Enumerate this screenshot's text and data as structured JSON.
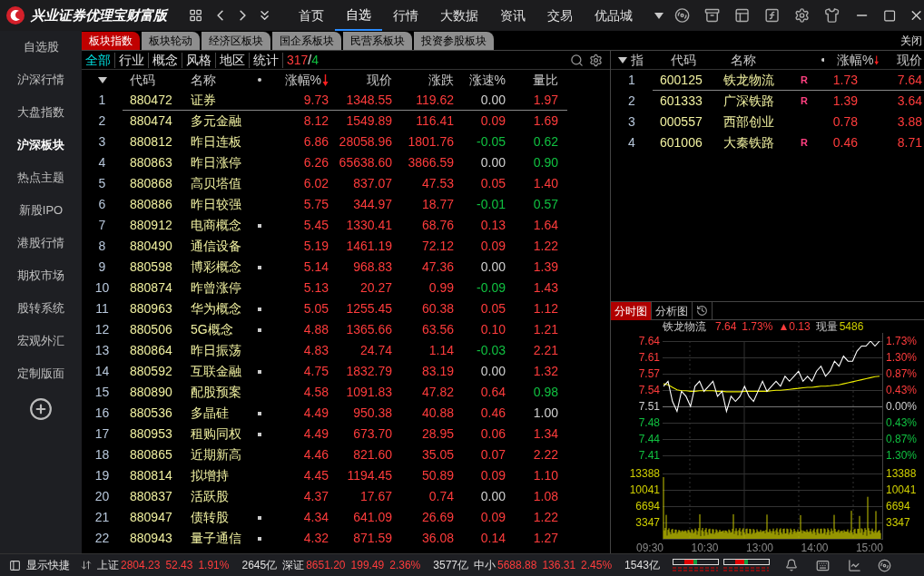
{
  "app": {
    "title": "兴业证券优理宝财富版"
  },
  "nav": [
    {
      "label": "首页",
      "selected": false
    },
    {
      "label": "自选",
      "selected": true
    },
    {
      "label": "行情",
      "selected": false
    },
    {
      "label": "大数据",
      "selected": false
    },
    {
      "label": "资讯",
      "selected": false
    },
    {
      "label": "交易",
      "selected": false
    },
    {
      "label": "优品城",
      "selected": false
    }
  ],
  "sidebar": {
    "items": [
      {
        "label": "自选股",
        "selected": false
      },
      {
        "label": "沪深行情",
        "selected": false
      },
      {
        "label": "大盘指数",
        "selected": false
      },
      {
        "label": "沪深板块",
        "selected": true
      },
      {
        "label": "热点主题",
        "selected": false
      },
      {
        "label": "新股IPO",
        "selected": false
      },
      {
        "label": "港股行情",
        "selected": false
      },
      {
        "label": "期权市场",
        "selected": false
      },
      {
        "label": "股转系统",
        "selected": false
      },
      {
        "label": "宏观外汇",
        "selected": false
      },
      {
        "label": "定制版面",
        "selected": false
      }
    ]
  },
  "board_tabs": [
    {
      "label": "板块指数",
      "selected": true
    },
    {
      "label": "板块轮动",
      "selected": false
    },
    {
      "label": "经济区板块",
      "selected": false
    },
    {
      "label": "国企系板块",
      "selected": false
    },
    {
      "label": "民营系板块",
      "selected": false
    },
    {
      "label": "投资参股板块",
      "selected": false
    }
  ],
  "close_label": "关闭",
  "filters": [
    {
      "label": "全部",
      "selected": true
    },
    {
      "label": "行业",
      "selected": false
    },
    {
      "label": "概念",
      "selected": false
    },
    {
      "label": "风格",
      "selected": false
    },
    {
      "label": "地区",
      "selected": false
    },
    {
      "label": "统计",
      "selected": false
    }
  ],
  "count": {
    "up": "317",
    "separator": "/",
    "down": "4"
  },
  "table": {
    "columns": [
      {
        "label": "代码",
        "sorted": false
      },
      {
        "label": "名称",
        "sorted": false
      },
      {
        "label": "涨幅%",
        "sorted": true
      },
      {
        "label": "现价",
        "sorted": false
      },
      {
        "label": "涨跌",
        "sorted": false
      },
      {
        "label": "涨速%",
        "sorted": false
      },
      {
        "label": "量比",
        "sorted": false
      }
    ],
    "rows": [
      {
        "index": "1",
        "code": "880472",
        "name": "证券",
        "marked": false,
        "selected": true,
        "values": [
          {
            "text": "9.73",
            "color": "#ff3c3c"
          },
          {
            "text": "1348.55",
            "color": "#ff3c3c"
          },
          {
            "text": "119.62",
            "color": "#ff3c3c"
          },
          {
            "text": "0.00",
            "color": "#d0d0d0"
          },
          {
            "text": "1.97",
            "color": "#ff3c3c"
          }
        ]
      },
      {
        "index": "2",
        "code": "880474",
        "name": "多元金融",
        "marked": false,
        "selected": false,
        "values": [
          {
            "text": "8.12",
            "color": "#ff3c3c"
          },
          {
            "text": "1549.89",
            "color": "#ff3c3c"
          },
          {
            "text": "116.41",
            "color": "#ff3c3c"
          },
          {
            "text": "0.09",
            "color": "#ff3c3c"
          },
          {
            "text": "1.69",
            "color": "#ff3c3c"
          }
        ]
      },
      {
        "index": "3",
        "code": "880812",
        "name": "昨日连板",
        "marked": false,
        "selected": false,
        "values": [
          {
            "text": "6.86",
            "color": "#ff3c3c"
          },
          {
            "text": "28058.96",
            "color": "#ff3c3c"
          },
          {
            "text": "1801.76",
            "color": "#ff3c3c"
          },
          {
            "text": "-0.05",
            "color": "#10c040"
          },
          {
            "text": "0.62",
            "color": "#10c040"
          }
        ]
      },
      {
        "index": "4",
        "code": "880863",
        "name": "昨日涨停",
        "marked": false,
        "selected": false,
        "values": [
          {
            "text": "6.26",
            "color": "#ff3c3c"
          },
          {
            "text": "65638.60",
            "color": "#ff3c3c"
          },
          {
            "text": "3866.59",
            "color": "#ff3c3c"
          },
          {
            "text": "0.00",
            "color": "#d0d0d0"
          },
          {
            "text": "0.90",
            "color": "#10c040"
          }
        ]
      },
      {
        "index": "5",
        "code": "880868",
        "name": "高贝塔值",
        "marked": false,
        "selected": false,
        "values": [
          {
            "text": "6.02",
            "color": "#ff3c3c"
          },
          {
            "text": "837.07",
            "color": "#ff3c3c"
          },
          {
            "text": "47.53",
            "color": "#ff3c3c"
          },
          {
            "text": "0.05",
            "color": "#ff3c3c"
          },
          {
            "text": "1.40",
            "color": "#ff3c3c"
          }
        ]
      },
      {
        "index": "6",
        "code": "880886",
        "name": "昨日较强",
        "marked": false,
        "selected": false,
        "values": [
          {
            "text": "5.75",
            "color": "#ff3c3c"
          },
          {
            "text": "344.97",
            "color": "#ff3c3c"
          },
          {
            "text": "18.77",
            "color": "#ff3c3c"
          },
          {
            "text": "-0.01",
            "color": "#10c040"
          },
          {
            "text": "0.57",
            "color": "#10c040"
          }
        ]
      },
      {
        "index": "7",
        "code": "880912",
        "name": "电商概念",
        "marked": true,
        "selected": false,
        "values": [
          {
            "text": "5.45",
            "color": "#ff3c3c"
          },
          {
            "text": "1330.41",
            "color": "#ff3c3c"
          },
          {
            "text": "68.76",
            "color": "#ff3c3c"
          },
          {
            "text": "0.13",
            "color": "#ff3c3c"
          },
          {
            "text": "1.64",
            "color": "#ff3c3c"
          }
        ]
      },
      {
        "index": "8",
        "code": "880490",
        "name": "通信设备",
        "marked": false,
        "selected": false,
        "values": [
          {
            "text": "5.19",
            "color": "#ff3c3c"
          },
          {
            "text": "1461.19",
            "color": "#ff3c3c"
          },
          {
            "text": "72.12",
            "color": "#ff3c3c"
          },
          {
            "text": "0.09",
            "color": "#ff3c3c"
          },
          {
            "text": "1.22",
            "color": "#ff3c3c"
          }
        ]
      },
      {
        "index": "9",
        "code": "880598",
        "name": "博彩概念",
        "marked": true,
        "selected": false,
        "values": [
          {
            "text": "5.14",
            "color": "#ff3c3c"
          },
          {
            "text": "968.83",
            "color": "#ff3c3c"
          },
          {
            "text": "47.36",
            "color": "#ff3c3c"
          },
          {
            "text": "0.00",
            "color": "#d0d0d0"
          },
          {
            "text": "1.39",
            "color": "#ff3c3c"
          }
        ]
      },
      {
        "index": "10",
        "code": "880874",
        "name": "昨曾涨停",
        "marked": false,
        "selected": false,
        "values": [
          {
            "text": "5.13",
            "color": "#ff3c3c"
          },
          {
            "text": "20.27",
            "color": "#ff3c3c"
          },
          {
            "text": "0.99",
            "color": "#ff3c3c"
          },
          {
            "text": "-0.09",
            "color": "#10c040"
          },
          {
            "text": "1.43",
            "color": "#ff3c3c"
          }
        ]
      },
      {
        "index": "11",
        "code": "880963",
        "name": "华为概念",
        "marked": true,
        "selected": false,
        "values": [
          {
            "text": "5.05",
            "color": "#ff3c3c"
          },
          {
            "text": "1255.45",
            "color": "#ff3c3c"
          },
          {
            "text": "60.38",
            "color": "#ff3c3c"
          },
          {
            "text": "0.05",
            "color": "#ff3c3c"
          },
          {
            "text": "1.12",
            "color": "#ff3c3c"
          }
        ]
      },
      {
        "index": "12",
        "code": "880506",
        "name": "5G概念",
        "marked": true,
        "selected": false,
        "values": [
          {
            "text": "4.88",
            "color": "#ff3c3c"
          },
          {
            "text": "1365.66",
            "color": "#ff3c3c"
          },
          {
            "text": "63.56",
            "color": "#ff3c3c"
          },
          {
            "text": "0.10",
            "color": "#ff3c3c"
          },
          {
            "text": "1.21",
            "color": "#ff3c3c"
          }
        ]
      },
      {
        "index": "13",
        "code": "880864",
        "name": "昨日振荡",
        "marked": false,
        "selected": false,
        "values": [
          {
            "text": "4.83",
            "color": "#ff3c3c"
          },
          {
            "text": "24.74",
            "color": "#ff3c3c"
          },
          {
            "text": "1.14",
            "color": "#ff3c3c"
          },
          {
            "text": "-0.03",
            "color": "#10c040"
          },
          {
            "text": "2.21",
            "color": "#ff3c3c"
          }
        ]
      },
      {
        "index": "14",
        "code": "880592",
        "name": "互联金融",
        "marked": true,
        "selected": false,
        "values": [
          {
            "text": "4.75",
            "color": "#ff3c3c"
          },
          {
            "text": "1832.79",
            "color": "#ff3c3c"
          },
          {
            "text": "83.19",
            "color": "#ff3c3c"
          },
          {
            "text": "0.00",
            "color": "#d0d0d0"
          },
          {
            "text": "1.32",
            "color": "#ff3c3c"
          }
        ]
      },
      {
        "index": "15",
        "code": "880890",
        "name": "配股预案",
        "marked": false,
        "selected": false,
        "values": [
          {
            "text": "4.58",
            "color": "#ff3c3c"
          },
          {
            "text": "1091.83",
            "color": "#ff3c3c"
          },
          {
            "text": "47.82",
            "color": "#ff3c3c"
          },
          {
            "text": "0.64",
            "color": "#ff3c3c"
          },
          {
            "text": "0.98",
            "color": "#10c040"
          }
        ]
      },
      {
        "index": "16",
        "code": "880536",
        "name": "多晶硅",
        "marked": true,
        "selected": false,
        "values": [
          {
            "text": "4.49",
            "color": "#ff3c3c"
          },
          {
            "text": "950.38",
            "color": "#ff3c3c"
          },
          {
            "text": "40.88",
            "color": "#ff3c3c"
          },
          {
            "text": "0.46",
            "color": "#ff3c3c"
          },
          {
            "text": "1.00",
            "color": "#d0d0d0"
          }
        ]
      },
      {
        "index": "17",
        "code": "880953",
        "name": "租购同权",
        "marked": true,
        "selected": false,
        "values": [
          {
            "text": "4.49",
            "color": "#ff3c3c"
          },
          {
            "text": "673.70",
            "color": "#ff3c3c"
          },
          {
            "text": "28.95",
            "color": "#ff3c3c"
          },
          {
            "text": "0.06",
            "color": "#ff3c3c"
          },
          {
            "text": "1.34",
            "color": "#ff3c3c"
          }
        ]
      },
      {
        "index": "18",
        "code": "880865",
        "name": "近期新高",
        "marked": false,
        "selected": false,
        "values": [
          {
            "text": "4.46",
            "color": "#ff3c3c"
          },
          {
            "text": "821.60",
            "color": "#ff3c3c"
          },
          {
            "text": "35.05",
            "color": "#ff3c3c"
          },
          {
            "text": "0.07",
            "color": "#ff3c3c"
          },
          {
            "text": "2.22",
            "color": "#ff3c3c"
          }
        ]
      },
      {
        "index": "19",
        "code": "880814",
        "name": "拟增持",
        "marked": false,
        "selected": false,
        "values": [
          {
            "text": "4.45",
            "color": "#ff3c3c"
          },
          {
            "text": "1194.45",
            "color": "#ff3c3c"
          },
          {
            "text": "50.89",
            "color": "#ff3c3c"
          },
          {
            "text": "0.09",
            "color": "#ff3c3c"
          },
          {
            "text": "1.10",
            "color": "#ff3c3c"
          }
        ]
      },
      {
        "index": "20",
        "code": "880837",
        "name": "活跃股",
        "marked": false,
        "selected": false,
        "values": [
          {
            "text": "4.37",
            "color": "#ff3c3c"
          },
          {
            "text": "17.67",
            "color": "#ff3c3c"
          },
          {
            "text": "0.74",
            "color": "#ff3c3c"
          },
          {
            "text": "0.00",
            "color": "#d0d0d0"
          },
          {
            "text": "1.08",
            "color": "#ff3c3c"
          }
        ]
      },
      {
        "index": "21",
        "code": "880947",
        "name": "债转股",
        "marked": true,
        "selected": false,
        "values": [
          {
            "text": "4.34",
            "color": "#ff3c3c"
          },
          {
            "text": "641.09",
            "color": "#ff3c3c"
          },
          {
            "text": "26.69",
            "color": "#ff3c3c"
          },
          {
            "text": "0.09",
            "color": "#ff3c3c"
          },
          {
            "text": "1.22",
            "color": "#ff3c3c"
          }
        ]
      },
      {
        "index": "22",
        "code": "880943",
        "name": "量子通信",
        "marked": true,
        "selected": false,
        "values": [
          {
            "text": "4.32",
            "color": "#ff3c3c"
          },
          {
            "text": "871.59",
            "color": "#ff3c3c"
          },
          {
            "text": "36.08",
            "color": "#ff3c3c"
          },
          {
            "text": "0.14",
            "color": "#ff3c3c"
          },
          {
            "text": "1.27",
            "color": "#ff3c3c"
          }
        ]
      }
    ]
  },
  "constituents": {
    "columns": [
      {
        "label": "指",
        "sorted": false
      },
      {
        "label": "代码",
        "sorted": false
      },
      {
        "label": "名称",
        "sorted": false
      },
      {
        "label": "涨幅%",
        "sorted": true
      },
      {
        "label": "现价",
        "sorted": false
      }
    ],
    "rows": [
      {
        "index": "1",
        "code": "600125",
        "name": "铁龙物流",
        "badge": "R",
        "selected": true,
        "values": [
          {
            "text": "1.73",
            "color": "#ff3c3c"
          },
          {
            "text": "7.64",
            "color": "#ff3c3c"
          }
        ]
      },
      {
        "index": "2",
        "code": "601333",
        "name": "广深铁路",
        "badge": "R",
        "selected": false,
        "values": [
          {
            "text": "1.39",
            "color": "#ff3c3c"
          },
          {
            "text": "3.64",
            "color": "#ff3c3c"
          }
        ]
      },
      {
        "index": "3",
        "code": "000557",
        "name": "西部创业",
        "selected": false,
        "values": [
          {
            "text": "0.78",
            "color": "#ff3c3c"
          },
          {
            "text": "3.88",
            "color": "#ff3c3c"
          }
        ]
      },
      {
        "index": "4",
        "code": "601006",
        "name": "大秦铁路",
        "badge": "R",
        "selected": false,
        "values": [
          {
            "text": "0.46",
            "color": "#ff3c3c"
          },
          {
            "text": "8.71",
            "color": "#ff3c3c"
          }
        ]
      }
    ]
  },
  "chart": {
    "tabs": [
      {
        "label": "分时图",
        "selected": true
      },
      {
        "label": "分析图",
        "selected": false
      }
    ],
    "name": "铁龙物流",
    "price": "7.64",
    "pct": "1.73%",
    "change": "▲0.13",
    "volume_label": "现量",
    "volume": "5486",
    "right_price_axis": [
      {
        "text": "1.73%",
        "color": "#ff3c3c"
      },
      {
        "text": "1.30%",
        "color": "#ff3c3c"
      },
      {
        "text": "0.87%",
        "color": "#ff3c3c"
      },
      {
        "text": "0.43%",
        "color": "#ff3c3c"
      },
      {
        "text": "0.00%",
        "color": "#d0d0d0"
      },
      {
        "text": "0.43%",
        "color": "#10c040"
      },
      {
        "text": "0.87%",
        "color": "#10c040"
      },
      {
        "text": "1.30%",
        "color": "#10c040"
      }
    ],
    "left_volume_axis": [
      "13388",
      "10041",
      "6694",
      "3347"
    ],
    "right_volume_axis": [
      "13388",
      "10041",
      "6694",
      "3347"
    ],
    "time_axis": [
      "09:30",
      "10:30",
      "13:00",
      "14:00",
      "15:00"
    ],
    "chart_data": {
      "type": "line",
      "ylim": [
        7.4125,
        7.64
      ],
      "grid": true,
      "ref_lines": [
        {
          "axis": "y",
          "value": 7.51
        }
      ],
      "yticks": [
        {
          "value": 7.64,
          "label": "7.64"
        },
        {
          "value": 7.6075,
          "label": "7.61"
        },
        {
          "value": 7.575,
          "label": "7.57"
        },
        {
          "value": 7.5425,
          "label": "7.54"
        },
        {
          "value": 7.51,
          "label": "7.51"
        },
        {
          "value": 7.4775,
          "label": "7.48"
        },
        {
          "value": 7.445,
          "label": "7.44"
        },
        {
          "value": 7.4125,
          "label": "7.41"
        }
      ],
      "series": [
        {
          "color": "#ffffff",
          "values": [
            7.55,
            7.56,
            7.52,
            7.5,
            7.54,
            7.53,
            7.51,
            7.55,
            7.56,
            7.54,
            7.55,
            7.56,
            7.53,
            7.54,
            7.5,
            7.53,
            7.52,
            7.53,
            7.55,
            7.53,
            7.52,
            7.54,
            7.56,
            7.54,
            7.55,
            7.56,
            7.55,
            7.57,
            7.56,
            7.57,
            7.58,
            7.56,
            7.57,
            7.56,
            7.58,
            7.59,
            7.57,
            7.58,
            7.6,
            7.59,
            7.61,
            7.6,
            7.6,
            7.62,
            7.63,
            7.63,
            7.64,
            7.63,
            7.64
          ]
        },
        {
          "color": "#f0f000",
          "values": [
            7.555,
            7.553,
            7.548,
            7.543,
            7.541,
            7.541,
            7.54,
            7.54,
            7.541,
            7.541,
            7.541,
            7.541,
            7.54,
            7.54,
            7.539,
            7.539,
            7.539,
            7.539,
            7.54,
            7.54,
            7.54,
            7.54,
            7.54,
            7.54,
            7.541,
            7.542,
            7.542,
            7.543,
            7.544,
            7.545,
            7.546,
            7.547,
            7.548,
            7.548,
            7.549,
            7.55,
            7.55,
            7.551,
            7.552,
            7.553,
            7.555,
            7.557,
            7.559,
            7.561,
            7.563,
            7.565,
            7.567,
            7.569,
            7.57
          ]
        }
      ]
    }
  },
  "status_bar": {
    "shortcut_label": "显示快捷",
    "indices": [
      {
        "name": "上证",
        "value": "2804.23",
        "change": "52.43",
        "pct": "1.91%",
        "amount": "2645亿"
      },
      {
        "name": "深证",
        "value": "8651.20",
        "change": "199.49",
        "pct": "2.36%",
        "amount": "3577亿"
      },
      {
        "name": "中小",
        "value": "5688.88",
        "change": "136.31",
        "pct": "2.45%",
        "amount": "1543亿"
      }
    ]
  }
}
